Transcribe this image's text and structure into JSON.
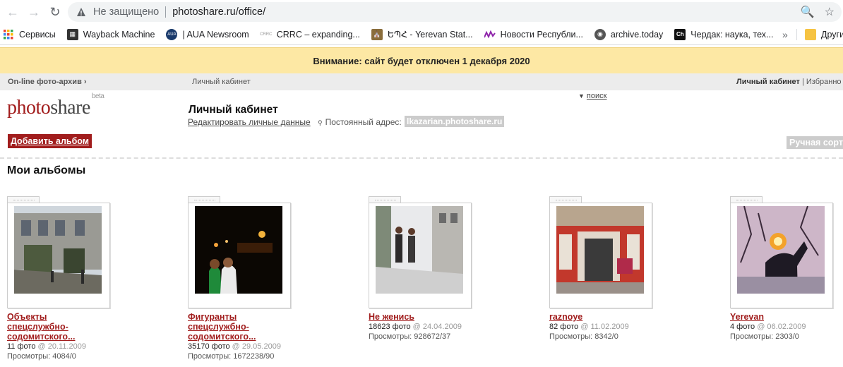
{
  "browser": {
    "not_secure": "Не защищено",
    "url": "photoshare.ru/office/",
    "bookmarks": [
      {
        "label": "Сервисы",
        "icon": "apps-grid-icon"
      },
      {
        "label": "Wayback Machine",
        "icon": "wayback-icon"
      },
      {
        "label": "| AUA Newsroom",
        "icon": "aua-icon"
      },
      {
        "label": "CRRC – expanding...",
        "icon": "crrc-icon"
      },
      {
        "label": "ԵՊՀ - Yerevan Stat...",
        "icon": "university-icon"
      },
      {
        "label": "Новости Республи...",
        "icon": "news-wave-icon"
      },
      {
        "label": "archive.today",
        "icon": "globe-icon"
      },
      {
        "label": "Чердак: наука, тех...",
        "icon": "ch-icon"
      }
    ],
    "more": "»",
    "other": "Другие"
  },
  "notice": "Внимание: сайт будет отключен 1 декабря 2020",
  "sitenav": {
    "home": "On-line фото-архив ›",
    "current": "Личный кабинет",
    "right_bold": "Личный кабинет",
    "right_rest": " | Избранно"
  },
  "logo": {
    "part1": "photo",
    "part2": "share",
    "beta": "beta"
  },
  "search": "поиск",
  "cabinet": {
    "title": "Личный кабинет",
    "edit": "Редактировать личные данные",
    "perm_label": "Постоянный адрес:",
    "perm_address": "lkazarian.photoshare.ru"
  },
  "add_album": "Добавить альбом",
  "sort": "Ручная сортир",
  "my_albums": "Мои альбомы",
  "albums": [
    {
      "title": "Объекты спецслужбно-содомитского...",
      "count": "11 фото",
      "date": "@ 20.11.2009",
      "views": "Просмотры: 4084/0"
    },
    {
      "title": "Фигуранты спецслужбно-содомитского...",
      "count": "35170 фото",
      "date": "@ 29.05.2009",
      "views": "Просмотры: 1672238/90"
    },
    {
      "title": "Не женись",
      "count": "18623 фото",
      "date": "@ 24.04.2009",
      "views": "Просмотры: 928672/37"
    },
    {
      "title": "raznoye",
      "count": "82 фото",
      "date": "@ 11.02.2009",
      "views": "Просмотры: 8342/0"
    },
    {
      "title": "Yerevan",
      "count": "4 фото",
      "date": "@ 06.02.2009",
      "views": "Просмотры: 2303/0"
    }
  ]
}
